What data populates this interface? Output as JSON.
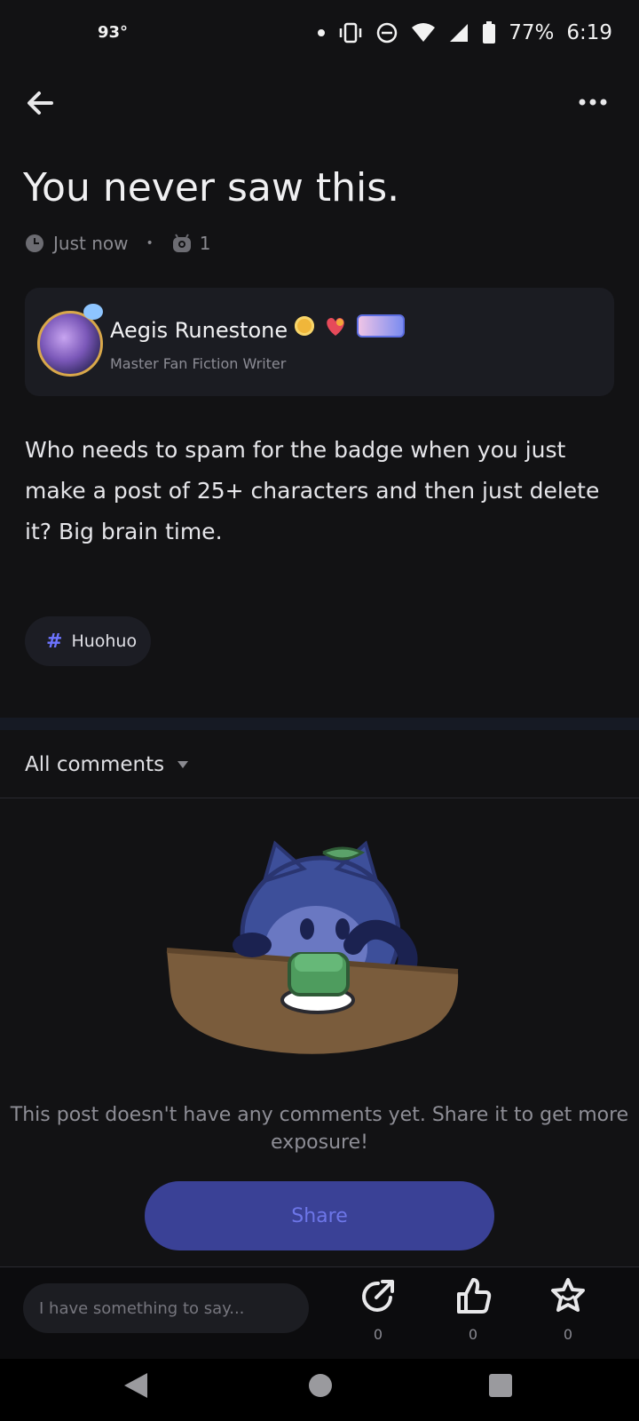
{
  "status_bar": {
    "temperature": "93°",
    "battery": "77%",
    "time": "6:19"
  },
  "post": {
    "title": "You never saw this.",
    "time": "Just now",
    "views": "1",
    "body": "Who needs to spam for the badge when you just make a post of 25+ characters and then just delete it? Big brain time.",
    "tag": "Huohuo"
  },
  "author": {
    "name": "Aegis Runestone",
    "role": "Master Fan Fiction Writer"
  },
  "comments": {
    "header": "All comments",
    "empty_text": "This post doesn't have any comments yet. Share it to get more exposure!",
    "share_label": "Share"
  },
  "bottom_bar": {
    "input_placeholder": "I have something to say...",
    "share_count": "0",
    "like_count": "0",
    "favorite_count": "0"
  },
  "colors": {
    "background": "#121214",
    "accent": "#3a4196",
    "accent_text": "#6d76e8",
    "tag_hash": "#6d74ff"
  }
}
